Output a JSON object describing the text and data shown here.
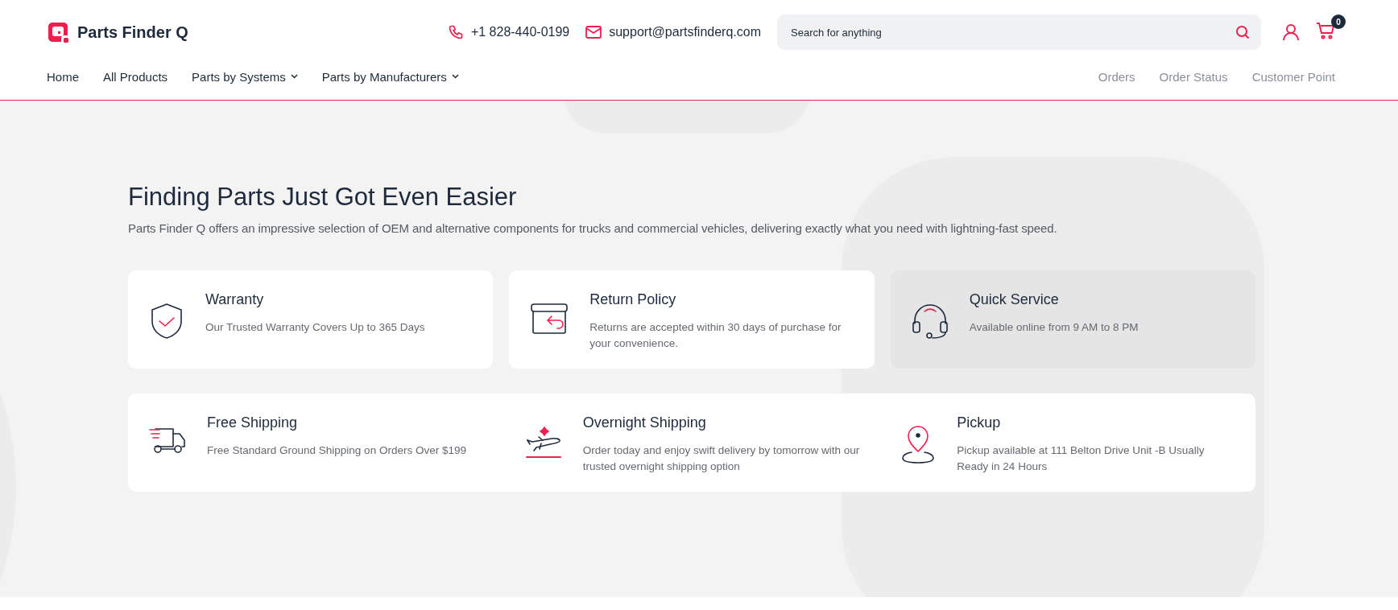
{
  "header": {
    "brand": "Parts Finder Q",
    "phone": "+1 828-440-0199",
    "email": "support@partsfinderq.com",
    "search": {
      "placeholder": "Search for anything"
    },
    "cart_count": "0"
  },
  "nav": {
    "main": [
      {
        "label": "Home",
        "dropdown": false
      },
      {
        "label": "All Products",
        "dropdown": false
      },
      {
        "label": "Parts by Systems",
        "dropdown": true
      },
      {
        "label": "Parts by Manufacturers",
        "dropdown": true
      }
    ],
    "secondary": [
      "Orders",
      "Order Status",
      "Customer Point"
    ]
  },
  "hero": {
    "title": "Finding Parts Just Got Even Easier",
    "text": "Parts Finder Q offers an impressive selection of OEM and alternative components for trucks and commercial vehicles, delivering exactly what you need with lightning-fast speed."
  },
  "features": [
    {
      "kind": "shield",
      "title": "Warranty",
      "text": "Our Trusted Warranty Covers Up to 365 Days",
      "highlighted": false
    },
    {
      "kind": "box",
      "title": "Return Policy",
      "text": "Returns are accepted within 30 days of purchase for your convenience.",
      "highlighted": false
    },
    {
      "kind": "headset",
      "title": "Quick Service",
      "text": "Available online from 9 AM to 8 PM",
      "highlighted": true
    }
  ],
  "services": [
    {
      "kind": "truck",
      "title": "Free Shipping",
      "text": "Free Standard Ground Shipping on Orders Over $199"
    },
    {
      "kind": "plane",
      "title": "Overnight Shipping",
      "text": "Order today and enjoy swift delivery by tomorrow with our trusted overnight shipping option"
    },
    {
      "kind": "pin",
      "title": "Pickup",
      "text": "Pickup available at 111 Belton Drive Unit -B Usually Ready in 24 Hours"
    }
  ]
}
